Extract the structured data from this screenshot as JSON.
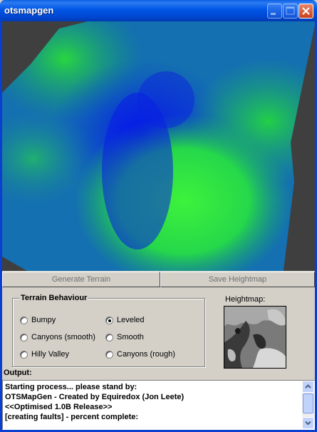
{
  "window": {
    "title": "otsmapgen"
  },
  "titlebar_buttons": {
    "minimize": "minimize-icon",
    "maximize": "maximize-icon",
    "close": "close-icon"
  },
  "toolbar": {
    "generate_label": "Generate Terrain",
    "save_label": "Save Heightmap"
  },
  "terrain_behaviour": {
    "title": "Terrain Behaviour",
    "options": [
      {
        "label": "Bumpy",
        "checked": false
      },
      {
        "label": "Canyons (smooth)",
        "checked": false
      },
      {
        "label": "Hilly Valley",
        "checked": false
      },
      {
        "label": "Leveled",
        "checked": true
      },
      {
        "label": "Smooth",
        "checked": false
      },
      {
        "label": "Canyons (rough)",
        "checked": false
      }
    ]
  },
  "heightmap": {
    "label": "Heightmap:"
  },
  "output": {
    "label": "Output:",
    "lines": [
      "Starting process... please stand by:",
      "OTSMapGen - Created by Equiredox (Jon Leete)",
      "<<Optimised 1.0B Release>>",
      "[creating faults] - percent complete:"
    ]
  },
  "colors": {
    "terrain_low": "#0018e0",
    "terrain_high": "#30ee30",
    "viewport_bg": "#3f3f3f"
  }
}
